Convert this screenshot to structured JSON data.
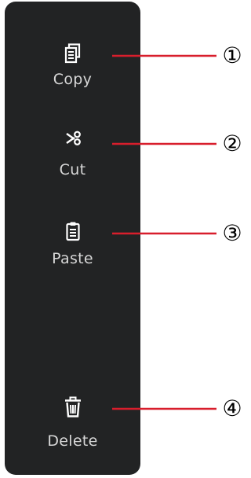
{
  "toolbar": {
    "copy_label": "Copy",
    "cut_label": "Cut",
    "paste_label": "Paste",
    "delete_label": "Delete"
  },
  "callouts": [
    "①",
    "②",
    "③",
    "④"
  ],
  "colors": {
    "panel_bg": "#222324",
    "label_text": "#d8d8d8",
    "icon": "#ffffff",
    "callout_line": "#d81e2c",
    "callout_number": "#000000"
  },
  "icons": [
    "copy-icon",
    "cut-icon",
    "paste-icon",
    "delete-icon"
  ]
}
